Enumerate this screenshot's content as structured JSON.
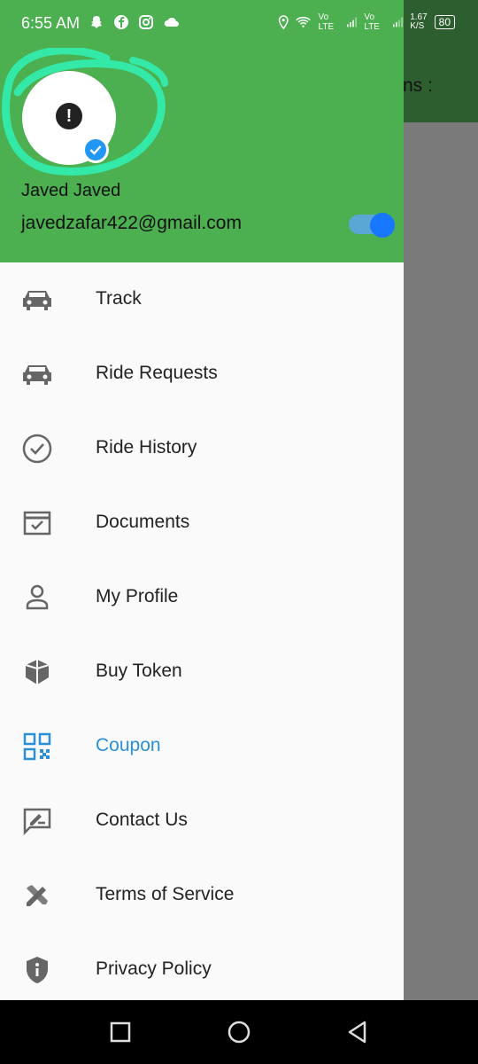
{
  "status_bar": {
    "time": "6:55 AM",
    "network_labels": [
      "Vo LTE",
      "Vo LTE"
    ],
    "speed": "1.67",
    "speed_unit": "K/S",
    "battery": "80"
  },
  "background_app": {
    "title_fragment": "ns :"
  },
  "drawer": {
    "user_name": "Javed Javed",
    "user_email": "javedzafar422@gmail.com",
    "toggle_on": true,
    "items": [
      {
        "label": "Track",
        "icon": "car-icon",
        "active": false
      },
      {
        "label": "Ride Requests",
        "icon": "car-icon",
        "active": false
      },
      {
        "label": "Ride History",
        "icon": "check-circle-icon",
        "active": false
      },
      {
        "label": "Documents",
        "icon": "document-check-icon",
        "active": false
      },
      {
        "label": "My Profile",
        "icon": "person-icon",
        "active": false
      },
      {
        "label": "Buy Token",
        "icon": "box-icon",
        "active": false
      },
      {
        "label": "Coupon",
        "icon": "qr-code-icon",
        "active": true
      },
      {
        "label": "Contact Us",
        "icon": "feedback-icon",
        "active": false
      },
      {
        "label": "Terms of Service",
        "icon": "tools-icon",
        "active": false
      },
      {
        "label": "Privacy Policy",
        "icon": "shield-info-icon",
        "active": false
      }
    ]
  },
  "colors": {
    "header_green": "#4caf50",
    "active_blue": "#2b8fd6",
    "toggle_blue": "#1976ff"
  }
}
